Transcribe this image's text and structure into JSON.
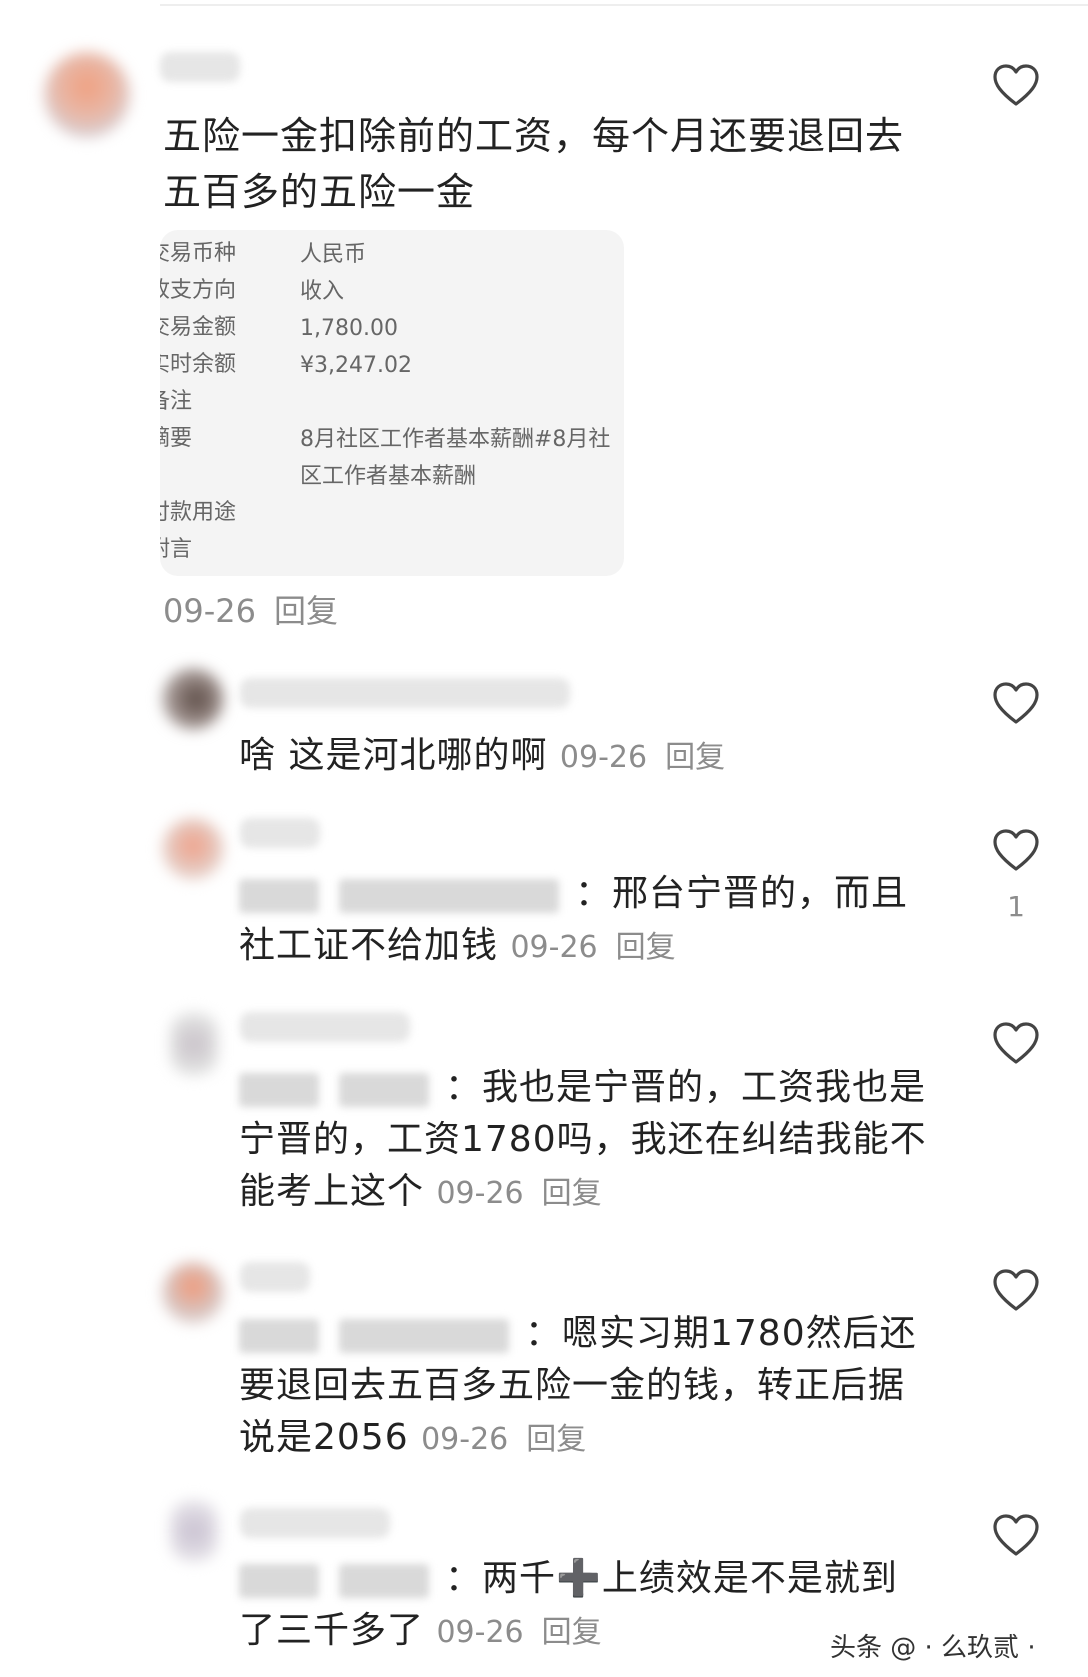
{
  "comments": [
    {
      "text": "五险一金扣除前的工资，每个月还要退回去五百多的五险一金",
      "date": "09-26",
      "reply_label": "回复",
      "attachment": {
        "rows": [
          {
            "label": "交易币种",
            "value": "人民币"
          },
          {
            "label": "收支方向",
            "value": "收入"
          },
          {
            "label": "交易金额",
            "value": "1,780.00"
          },
          {
            "label": "实时余额",
            "value": "¥3,247.02"
          },
          {
            "label": "备注",
            "value": ""
          },
          {
            "label": "摘要",
            "value": "8月社区工作者基本薪酬#8月社区工作者基本薪酬"
          },
          {
            "label": "付款用途",
            "value": ""
          },
          {
            "label": "附言",
            "value": ""
          }
        ]
      }
    },
    {
      "text": "啥 这是河北哪的啊",
      "date": "09-26",
      "reply_label": "回复"
    },
    {
      "text": "：邢台宁晋的，而且社工证不给加钱",
      "date": "09-26",
      "reply_label": "回复",
      "like_count": "1"
    },
    {
      "text": "：我也是宁晋的，工资我也是宁晋的，工资1780吗，我还在纠结我能不能考上这个",
      "date": "09-26",
      "reply_label": "回复"
    },
    {
      "text": "：嗯实习期1780然后还要退回去五百多五险一金的钱，转正后据说是2056",
      "date": "09-26",
      "reply_label": "回复"
    },
    {
      "text": "：两千➕上绩效是不是就到了三千多了",
      "date": "09-26",
      "reply_label": "回复"
    }
  ],
  "watermark": "头条 @ · 么玖贰 ·",
  "colors": {
    "text": "#222222",
    "meta": "#8c8c8c",
    "card": "#f4f4f4",
    "heart": "#444444"
  },
  "icons": {
    "like": "heart-outline-icon"
  }
}
